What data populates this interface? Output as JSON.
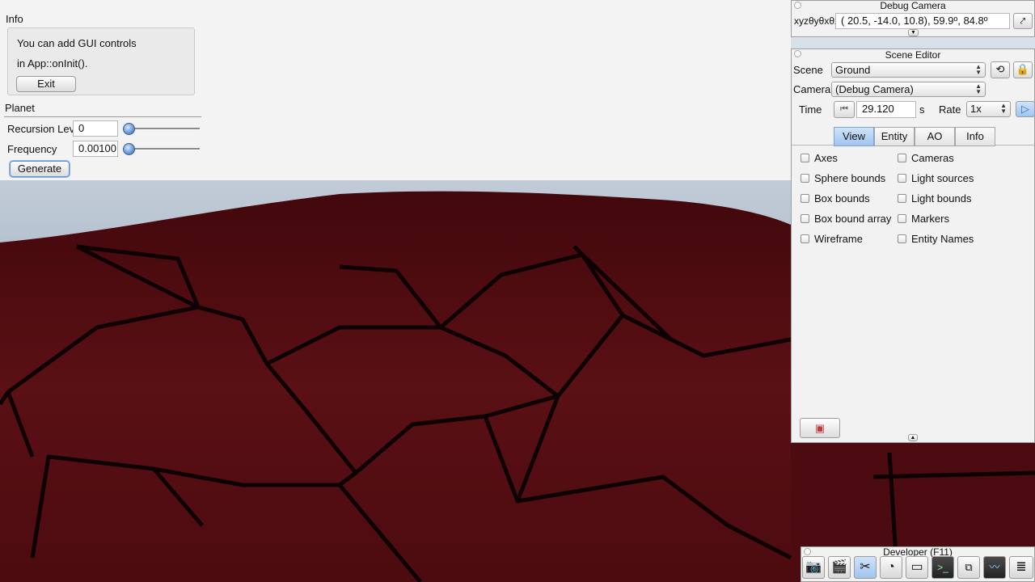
{
  "info_panel": {
    "title": "Info",
    "line1": "You can add GUI controls",
    "line2": "in App::onInit().",
    "exit_label": "Exit"
  },
  "planet_panel": {
    "title": "Planet",
    "recursion_label": "Recursion Leve",
    "recursion_value": "0",
    "frequency_label": "Frequency",
    "frequency_value": "0.00100",
    "generate_label": "Generate"
  },
  "debug_camera": {
    "title": "Debug Camera",
    "xyz_label": "xyzθyθxθz",
    "coords": "( 20.5, -14.0,  10.8),  59.9º,  84.8º"
  },
  "scene_editor": {
    "title": "Scene Editor",
    "scene_label": "Scene",
    "scene_value": "Ground",
    "camera_label": "Camera",
    "camera_value": "(Debug Camera)",
    "time_label": "Time",
    "time_value": "29.120",
    "time_unit": "s",
    "rate_label": "Rate",
    "rate_value": "1x",
    "tabs": [
      "View",
      "Entity",
      "AO",
      "Info"
    ],
    "active_tab": "View",
    "left_options": [
      "Axes",
      "Sphere bounds",
      "Box bounds",
      "Box bound array",
      "Wireframe"
    ],
    "right_options": [
      "Cameras",
      "Light sources",
      "Light bounds",
      "Markers",
      "Entity Names"
    ]
  },
  "developer": {
    "title": "Developer (F11)",
    "tools": [
      "camera-icon",
      "clapperboard-icon",
      "tools-icon",
      "speed-icon",
      "note-icon",
      "console-icon",
      "windows-icon",
      "profiler-icon",
      "document-icon"
    ]
  },
  "colors": {
    "accent": "#9fc4f0",
    "terrain": "#5a1015",
    "sky": "#e9eef4"
  }
}
